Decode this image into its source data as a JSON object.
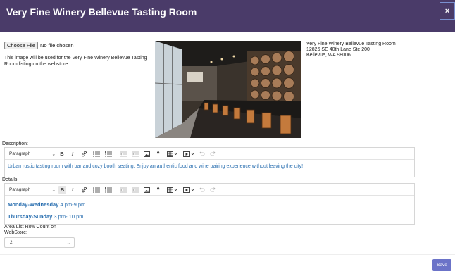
{
  "modal": {
    "title": "Very Fine Winery Bellevue Tasting Room",
    "close_label": "×"
  },
  "image_upload": {
    "button_label": "Choose File",
    "status": "No file chosen",
    "note": "This image will be used for the Very Fine Winery Bellevue Tasting Room listing on the webstore."
  },
  "address": {
    "line1": "Very Fine Winery Bellevue Tasting Room",
    "line2": "12826 SE 40th Lane Ste 200",
    "line3": "Bellevue, WA 98006"
  },
  "description": {
    "label": "Description:",
    "text": "Urban rustic tasting room with bar and cozy booth seating. Enjoy an authentic food and wine pairing experience without leaving the city!"
  },
  "details": {
    "label": "Details:",
    "line1_bold": "Monday-Wednesday",
    "line1_rest": " 4 pm-9 pm",
    "line2_bold": "Thursday-Sunday",
    "line2_rest": " 3 pm- 10 pm"
  },
  "toolbar": {
    "paragraph_label": "Paragraph",
    "bold": "B",
    "italic": "I",
    "quote": "❝",
    "icons": [
      "chevron-down-icon",
      "bold-icon",
      "italic-icon",
      "link-icon",
      "bulleted-list-icon",
      "numbered-list-icon",
      "outdent-icon",
      "indent-icon",
      "image-icon",
      "quote-icon",
      "table-icon",
      "media-icon",
      "undo-icon",
      "redo-icon"
    ]
  },
  "row_count": {
    "label_line1": "Area List Row Count on",
    "label_line2": "WebStore:",
    "value": "2"
  },
  "footer": {
    "save_label": "Save"
  },
  "colors": {
    "header_bg": "#4a3b69",
    "accent": "#6b73c8",
    "link_text": "#2a6fb0"
  }
}
